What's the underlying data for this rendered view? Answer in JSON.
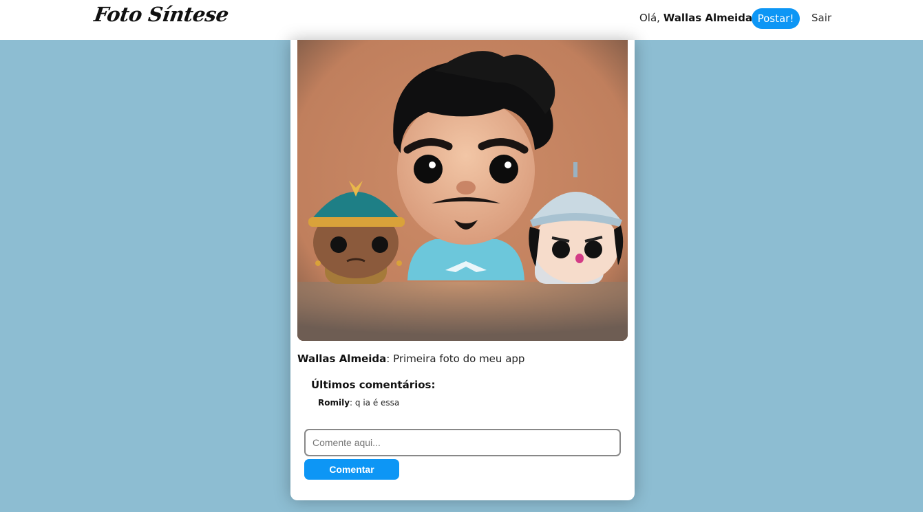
{
  "navbar": {
    "logo_text": "Foto Síntese",
    "greeting_prefix": "Olá, ",
    "username": "Wallas Almeida",
    "post_label": "Postar!",
    "logout_label": "Sair"
  },
  "post": {
    "author": "Wallas Almeida",
    "caption": ": Primeira foto do meu app",
    "comments_title": "Últimos comentários:",
    "comments": [
      {
        "author": "Romily",
        "text": ": q ia é essa"
      }
    ],
    "comment_placeholder": "Comente aqui...",
    "comment_button": "Comentar"
  },
  "colors": {
    "page_background": "#8dbdd2",
    "accent": "#0d96f5"
  }
}
